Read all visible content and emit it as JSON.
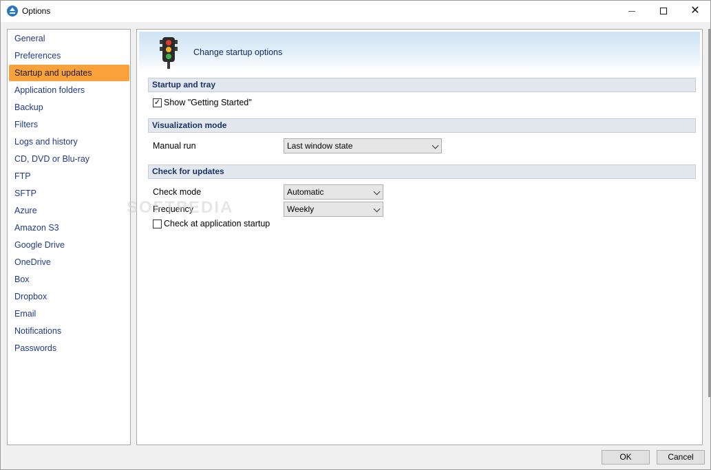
{
  "window": {
    "title": "Options",
    "controls": {
      "minimize": "minimize",
      "maximize": "maximize",
      "close": "✕"
    }
  },
  "nav": {
    "items": [
      {
        "label": "General"
      },
      {
        "label": "Preferences"
      },
      {
        "label": "Startup and updates",
        "active": true
      },
      {
        "label": "Application folders"
      },
      {
        "label": "Backup"
      },
      {
        "label": "Filters"
      },
      {
        "label": "Logs and history"
      },
      {
        "label": "CD, DVD or Blu-ray"
      },
      {
        "label": "FTP"
      },
      {
        "label": "SFTP"
      },
      {
        "label": "Azure"
      },
      {
        "label": "Amazon S3"
      },
      {
        "label": "Google Drive"
      },
      {
        "label": "OneDrive"
      },
      {
        "label": "Box"
      },
      {
        "label": "Dropbox"
      },
      {
        "label": "Email"
      },
      {
        "label": "Notifications"
      },
      {
        "label": "Passwords"
      }
    ],
    "active_color": "#f9a13a",
    "link_color": "#1f3a8a"
  },
  "panel": {
    "header_title": "Change startup options",
    "header_icon": "traffic-light-icon",
    "sections": {
      "startup": {
        "title": "Startup and tray",
        "show_getting_started": {
          "label": "Show \"Getting Started\"",
          "checked": true
        }
      },
      "visualization": {
        "title": "Visualization mode",
        "manual_run": {
          "label": "Manual run",
          "value": "Last window state"
        }
      },
      "updates": {
        "title": "Check for updates",
        "check_mode": {
          "label": "Check mode",
          "value": "Automatic"
        },
        "frequency": {
          "label": "Frequency",
          "value": "Weekly"
        },
        "check_at_startup": {
          "label": "Check at application startup",
          "checked": false
        }
      }
    }
  },
  "watermark": "SOFTPEDIA",
  "buttons": {
    "ok": "OK",
    "cancel": "Cancel"
  }
}
